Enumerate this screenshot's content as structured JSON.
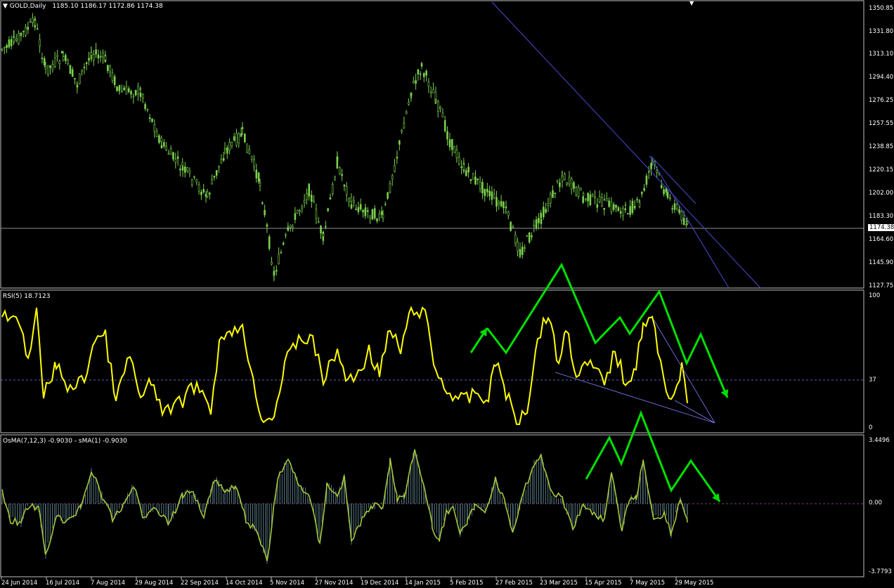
{
  "main": {
    "title": "GOLD,Daily",
    "ohlc": "1185.10 1186.17 1172.86 1174.38",
    "current_price": "1174.38",
    "axis_labels": [
      "1350.85",
      "1331.80",
      "1313.10",
      "1294.40",
      "1276.25",
      "1257.55",
      "1238.85",
      "1220.15",
      "1202.00",
      "1183.30",
      "1164.60",
      "1145.90",
      "1127.75"
    ]
  },
  "rsi": {
    "title": "RSI(5) 18.7123",
    "axis_labels": [
      "100",
      "37",
      "0"
    ]
  },
  "osma": {
    "title": "OsMA(7,12,3) -0.9030  - sMA(1) -0.9030",
    "axis_labels": [
      "3.4496",
      "0.00",
      "-3.7793"
    ]
  },
  "time_axis": [
    "24 Jun 2014",
    "16 Jul 2014",
    "7 Aug 2014",
    "29 Aug 2014",
    "22 Sep 2014",
    "14 Oct 2014",
    "5 Nov 2014",
    "27 Nov 2014",
    "19 Dec 2014",
    "14 Jan 2015",
    "5 Feb 2015",
    "27 Feb 2015",
    "23 Mar 2015",
    "15 Apr 2015",
    "7 May 2015",
    "29 May 2015"
  ],
  "colors": {
    "candles": "#7bd14d",
    "rsi_line": "#ffff00",
    "osma_line": "#a6c83a",
    "osma_bars": "#5a7a86",
    "arrows": "#00e000",
    "trendlines": "#4a4ad0",
    "level_line": "#8080ff"
  }
}
